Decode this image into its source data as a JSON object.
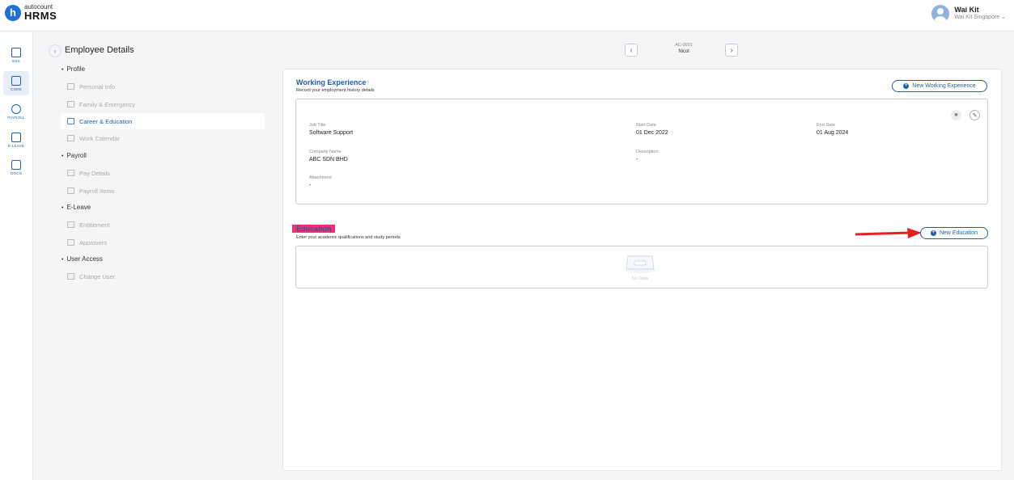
{
  "brand": {
    "top": "autocount",
    "bottom": "HRMS",
    "mark": "h"
  },
  "user": {
    "name": "Wai Kit",
    "org": "Wai Kit Singapore ⌄"
  },
  "rail": [
    {
      "label": "ESS"
    },
    {
      "label": "CORE"
    },
    {
      "label": "PAYROLL"
    },
    {
      "label": "E-LEAVE"
    },
    {
      "label": "DOCS"
    }
  ],
  "subnav": {
    "title": "Employee Details",
    "back": "‹",
    "sections": {
      "profile": "Profile",
      "payroll": "Payroll",
      "eleave": "E-Leave",
      "access": "User Access"
    },
    "items": {
      "personal_info": "Personal Info",
      "family": "Family & Emergency",
      "career": "Career & Education",
      "calendar": "Work Calendar",
      "pay_details": "Pay Details",
      "payroll_items": "Payroll Items",
      "entitlement": "Entitlement",
      "approvers": "Approvers",
      "change_user": "Change User"
    }
  },
  "employee": {
    "code": "AC-0001",
    "name": "Nicol",
    "prev": "‹",
    "next": "›"
  },
  "working_experience": {
    "title": "Working Experience",
    "subtitle": "Record your employment history details",
    "new_label": "New Working Experience",
    "job_title_label": "Job Title",
    "job_title": "Software Support",
    "start_label": "Start Date",
    "start": "01 Dec 2022",
    "end_label": "End Date",
    "end": "01 Aug 2024",
    "company_label": "Company Name",
    "company": "ABC SDN BHD",
    "desc_label": "Description",
    "desc": "-",
    "attach_label": "Attachment",
    "attach": "-"
  },
  "education": {
    "title": "Education",
    "subtitle": "Enter your academic qualifications and study periods",
    "new_label": "New Education",
    "empty": "No Data"
  },
  "colors": {
    "accent": "#1f5fa8",
    "highlight": "#f2336b",
    "arrow": "#e8201f"
  }
}
